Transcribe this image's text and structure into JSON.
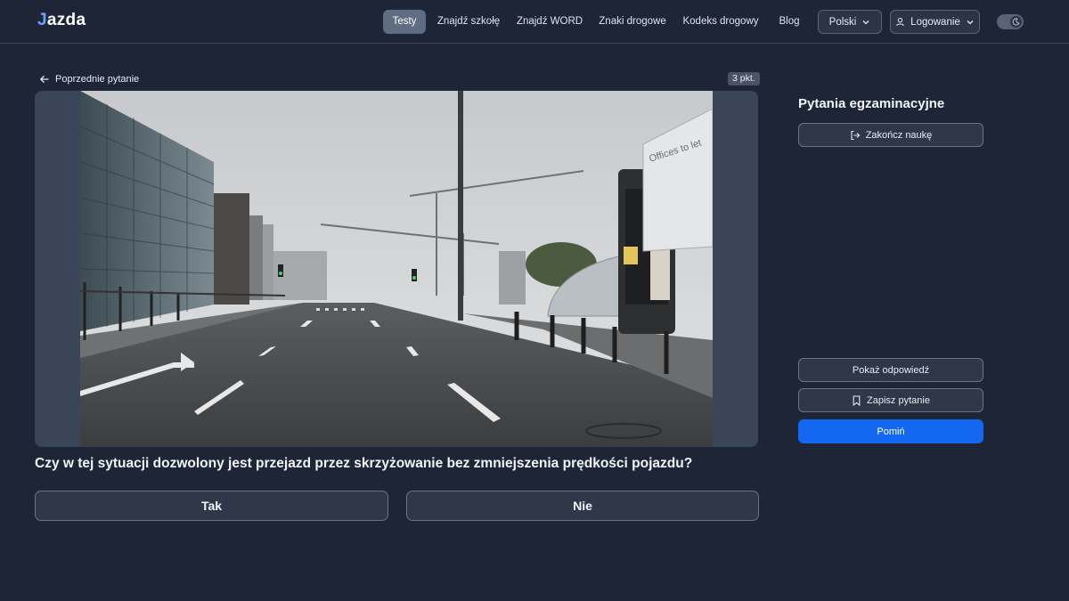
{
  "nav": {
    "logo_prefix": "J",
    "logo_rest": "azda",
    "items": [
      {
        "label": "Testy",
        "active": true
      },
      {
        "label": "Znajdź szkołę",
        "active": false
      },
      {
        "label": "Znajdź WORD",
        "active": false
      },
      {
        "label": "Znaki drogowe",
        "active": false
      },
      {
        "label": "Kodeks drogowy",
        "active": false
      },
      {
        "label": "Blog",
        "active": false
      }
    ],
    "language": "Polski",
    "login": "Logowanie",
    "theme_toggle_icon": "moon-icon"
  },
  "question": {
    "back_label": "Poprzednie pytanie",
    "points": "3 pkt.",
    "text": "Czy w tej sytuacji dozwolony jest przejazd przez skrzyżowanie bez zmniejszenia prędkości pojazdu?",
    "answers": [
      "Tak",
      "Nie"
    ],
    "media_sign_text": "Offices to let"
  },
  "sidebar": {
    "title": "Pytania egzaminacyjne",
    "end_label": "Zakończ naukę",
    "show_answer_label": "Pokaż odpowiedź",
    "save_label": "Zapisz pytanie",
    "skip_label": "Pomiń"
  },
  "colors": {
    "background": "#1e2536",
    "primary": "#1467f0",
    "nav_active": "#5f6c82"
  }
}
